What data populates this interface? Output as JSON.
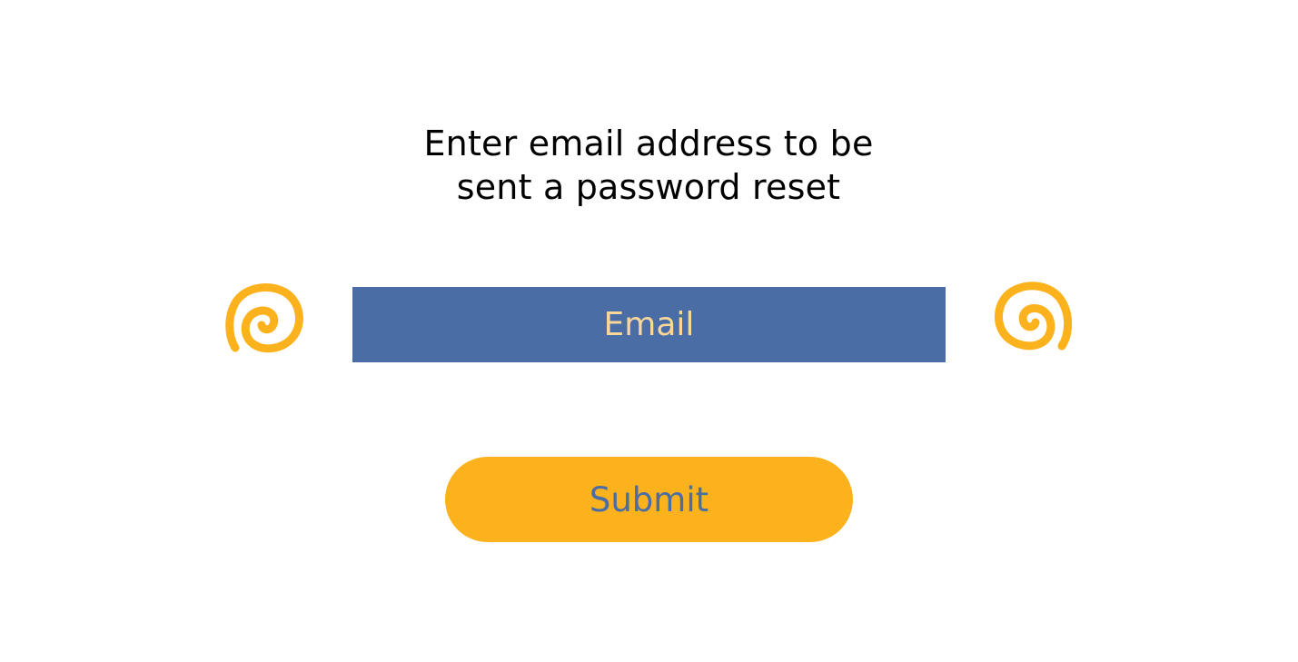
{
  "instructions": {
    "line1": "Enter  email address to be",
    "line2": "sent a password reset"
  },
  "email_field": {
    "placeholder": "Email",
    "value": ""
  },
  "submit_button": {
    "label": "Submit"
  },
  "decorations": {
    "left_icon": "swirl-icon",
    "right_icon": "swirl-icon"
  },
  "colors": {
    "background": "#ffffff",
    "text": "#000000",
    "field_background": "#4a6da5",
    "field_placeholder": "#f7d79a",
    "button_background": "#fcb21d",
    "button_text": "#4a6da5",
    "swirl": "#fcb21d"
  }
}
